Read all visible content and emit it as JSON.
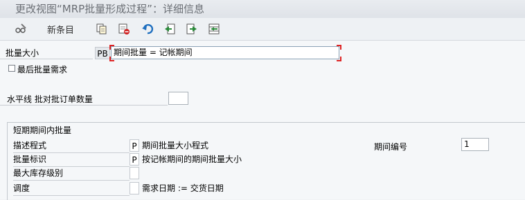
{
  "title": "更改视图“MRP批量形成过程”：详细信息",
  "toolbar": {
    "new_entries_label": "新条目",
    "icons": [
      "glasses-edit-icon",
      "copy-icon",
      "delete-icon",
      "undo-icon",
      "previous-entry-icon",
      "next-entry-icon",
      "select-icon"
    ]
  },
  "form": {
    "lot_size_label": "批量大小",
    "lot_size_code": "PB",
    "lot_size_value": "期间批量 = 记帐期间",
    "last_lot_label": "最后批量需求",
    "horizon_label": "水平线 批对批订单数量",
    "horizon_value": ""
  },
  "short_term": {
    "title": "短期期间内批量",
    "rows": [
      {
        "label": "描述程式",
        "code": "P",
        "desc": "期间批量大小程式"
      },
      {
        "label": "批量标识",
        "code": "P",
        "desc": "按记帐期间的期间批量大小"
      },
      {
        "label": "最大库存级别",
        "code": "",
        "desc": ""
      },
      {
        "label": "调度",
        "code": "",
        "desc": "需求日期 := 交货日期"
      }
    ],
    "period_number_label": "期间编号",
    "period_number_value": "1"
  },
  "colors": {
    "focus_corner": "#dd2222",
    "icon_green": "#2a8a3a",
    "icon_blue": "#1f6fbf",
    "icon_red": "#d02020"
  }
}
